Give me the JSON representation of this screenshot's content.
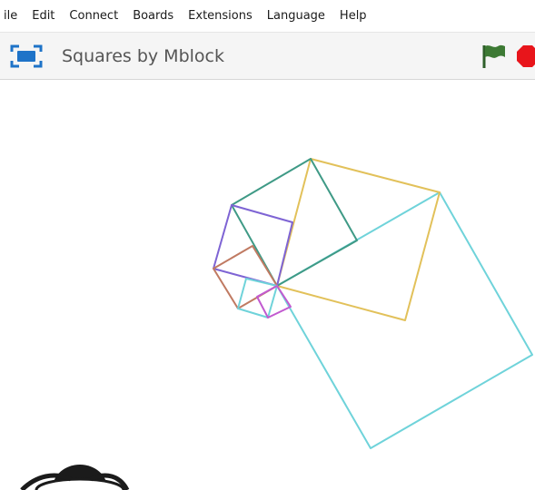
{
  "menubar": {
    "items": [
      {
        "label": "ile"
      },
      {
        "label": "Edit"
      },
      {
        "label": "Connect"
      },
      {
        "label": "Boards"
      },
      {
        "label": "Extensions"
      },
      {
        "label": "Language"
      },
      {
        "label": "Help"
      }
    ]
  },
  "titlebar": {
    "project_title": "Squares by Mblock"
  },
  "icons": {
    "fullscreen": "fullscreen-icon",
    "green_flag": "green-flag-icon",
    "stop": "stop-icon",
    "sprite": "panda-sprite"
  },
  "colors": {
    "accent_blue": "#1e73c8",
    "flag_green": "#3d7a34",
    "stop_red": "#e8151b",
    "line_cyan": "#6fd3da",
    "line_gold": "#e2c15a",
    "line_teal": "#3f9a86",
    "line_purple": "#7e64d4",
    "line_brown": "#c07a62",
    "line_magenta": "#c25ad0"
  }
}
